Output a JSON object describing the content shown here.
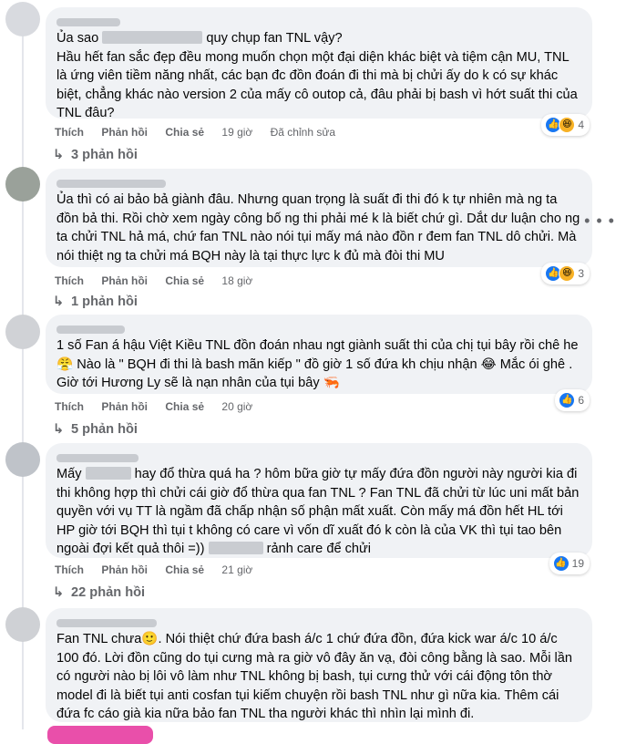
{
  "actions": {
    "like": "Thích",
    "reply": "Phản hồi",
    "share": "Chia sẻ",
    "edited": "Đã chỉnh sửa"
  },
  "comments": [
    {
      "text_a": "Ủa sao ",
      "text_b": " quy chụp fan TNL vậy?\nHầu hết fan sắc đẹp đều mong muốn chọn một đại diện khác biệt và tiệm cận MU, TNL là ứng viên tiềm năng nhất, các bạn đc đồn đoán đi thi mà bị chửi ấy do k có sự khác biệt, chẳng khác nào version 2 của mấy cô outop cả, đâu phải bị bash vì hớt suất thi của TNL đâu?",
      "time": "19 giờ",
      "reaction_count": "4",
      "replies": "3 phản hồi"
    },
    {
      "text": "Ủa thì có ai bảo bả giành đâu. Nhưng quan trọng là suất đi thi đó k tự nhiên mà ng ta đồn bả thi. Rồi chờ xem ngày công bố ng thi phải mé k là biết chứ gì. Dắt dư luận cho ng ta chửi TNL hả má, chứ fan TNL nào nói tụi mấy má nào đồn r đem fan TNL dô chửi. Mà nói thiệt ng ta chửi má BQH này là tại thực lực k đủ mà đòi thi MU",
      "time": "18 giờ",
      "reaction_count": "3",
      "replies": "1 phản hồi"
    },
    {
      "text": "1 số Fan á hậu Việt Kiều TNL đồn đoán nhau ngt giành suất thi của chị tụi bây rồi chê he 😤 Nào là \" BQH đi thi là bash mãn kiếp \" đồ giờ 1 số đứa kh chịu nhận 😂 Mắc ói ghê . Giờ tới Hương Ly sẽ là nạn nhân của tụi bây 🦐",
      "time": "20 giờ",
      "reaction_count": "6",
      "replies": "5 phản hồi"
    },
    {
      "text_a": "Mấy ",
      "text_b": " hay đổ thừa quá ha ? hôm bữa giờ tự mấy đứa đồn người này người kia đi thi không hợp thì chửi cái giờ đổ thừa qua fan TNL ? Fan TNL đã chửi từ lúc uni mất bản quyền với vụ TT là ngầm đã chấp nhận số phận mất xuất. Còn mấy má đồn hết HL tới HP giờ tới BQH thì tụi t không có care vì vốn dĩ xuất đó k còn là của VK thì tụi tao bên ngoài đợi kết quả thôi =)) ",
      "text_c": " rảnh care để chửi",
      "time": "21 giờ",
      "reaction_count": "19",
      "replies": "22 phản hồi"
    },
    {
      "text": "Fan TNL chưa🙂. Nói thiệt chứ đứa bash á/c 1 chứ đứa đồn, đứa kick war á/c 10 á/c 100 đó. Lời đồn cũng do tụi cưng mà ra giờ vô đây ăn vạ, đòi công bằng là sao. Mỗi lần có người nào bị lôi vô làm như TNL không bị bash, tụi cưng thử với cái động tôn thờ model đi là biết tụi anti cosfan tụi kiếm chuyện rồi bash TNL như gì nữa kia. Thêm cái đứa fc cáo già kia nữa bảo fan TNL tha người khác thì nhìn lại mình đi."
    }
  ],
  "more": "• • •"
}
